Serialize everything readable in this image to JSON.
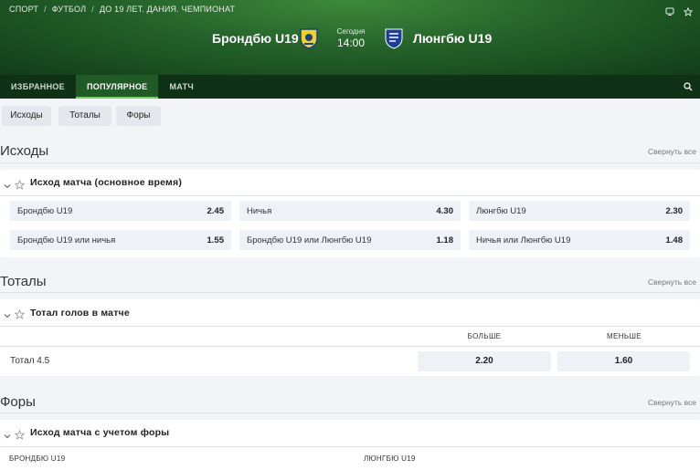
{
  "breadcrumb": [
    "СПОРТ",
    "ФУТБОЛ",
    "ДО 19 ЛЕТ. ДАНИЯ. ЧЕМПИОНАТ"
  ],
  "match": {
    "home": "Брондбю U19",
    "away": "Люнгбю U19",
    "day": "Сегодня",
    "time": "14:00"
  },
  "tabs": [
    "ИЗБРАННОЕ",
    "ПОПУЛЯРНОЕ",
    "МАТЧ"
  ],
  "active_tab": "ПОПУЛЯРНОЕ",
  "filters": [
    "Исходы",
    "Тоталы",
    "Форы"
  ],
  "sections": {
    "outcomes": {
      "title": "Исходы",
      "collapse": "Свернуть все",
      "market_title": "Исход матча (основное время)",
      "odds": [
        {
          "label": "Брондбю U19",
          "value": "2.45"
        },
        {
          "label": "Ничья",
          "value": "4.30"
        },
        {
          "label": "Люнгбю U19",
          "value": "2.30"
        },
        {
          "label": "Брондбю U19 или ничья",
          "value": "1.55"
        },
        {
          "label": "Брондбю U19 или Люнгбю U19",
          "value": "1.18"
        },
        {
          "label": "Ничья или Люнгбю U19",
          "value": "1.48"
        }
      ]
    },
    "totals": {
      "title": "Тоталы",
      "collapse": "Свернуть все",
      "market_title": "Тотал голов в матче",
      "col_over": "БОЛЬШЕ",
      "col_under": "МЕНЬШЕ",
      "row_label": "Тотал 4.5",
      "over": "2.20",
      "under": "1.60"
    },
    "handicaps": {
      "title": "Форы",
      "collapse": "Свернуть все",
      "market_title": "Исход матча с учетом форы",
      "home_col": "БРОНДБЮ U19",
      "away_col": "ЛЮНГБЮ U19"
    }
  },
  "colors": {
    "header_green": "#24632a",
    "tab_bar": "#0f3217",
    "accent": "#6fd35a",
    "odd_bg": "#eef1f5"
  },
  "icons": [
    "monitor-icon",
    "star-outline-icon",
    "home-team-crest-icon",
    "away-team-crest-icon",
    "search-icon",
    "chevron-down-icon",
    "favorite-star-icon"
  ]
}
